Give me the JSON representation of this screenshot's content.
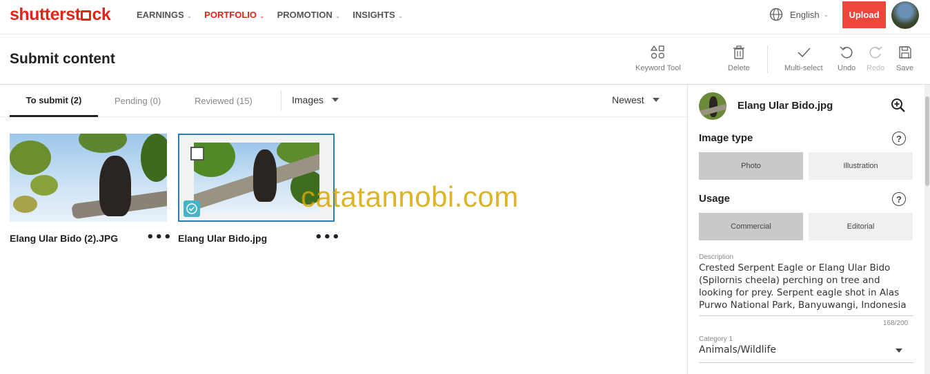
{
  "nav": {
    "logo_left": "shutterst",
    "logo_right": "ck",
    "items": [
      {
        "label": "EARNINGS",
        "active": false
      },
      {
        "label": "PORTFOLIO",
        "active": true
      },
      {
        "label": "PROMOTION",
        "active": false
      },
      {
        "label": "INSIGHTS",
        "active": false
      }
    ],
    "language": "English",
    "upload_label": "Upload"
  },
  "header": {
    "title": "Submit content",
    "tools": {
      "keyword_tool": "Keyword Tool",
      "delete": "Delete",
      "multi_select": "Multi-select",
      "undo": "Undo",
      "redo": "Redo",
      "save": "Save"
    }
  },
  "tabs": {
    "to_submit": "To submit (2)",
    "pending": "Pending (0)",
    "reviewed": "Reviewed (15)",
    "media_filter": "Images",
    "sort": "Newest"
  },
  "cards": [
    {
      "name": "Elang Ular Bido (2).JPG",
      "selected": false
    },
    {
      "name": "Elang Ular Bido.jpg",
      "selected": true
    }
  ],
  "watermark": "catatannobi.com",
  "panel": {
    "file_name": "Elang Ular Bido.jpg",
    "image_type_title": "Image type",
    "image_type_options": [
      "Photo",
      "Illustration"
    ],
    "image_type_selected": "Photo",
    "usage_title": "Usage",
    "usage_options": [
      "Commercial",
      "Editorial"
    ],
    "usage_selected": "Commercial",
    "description_label": "Description",
    "description": "Crested Serpent Eagle or Elang Ular Bido (Spilornis cheela) perching on tree and looking for prey. Serpent eagle shot in Alas Purwo National Park, Banyuwangi, Indonesia",
    "description_counter": "168/200",
    "category_label": "Category 1",
    "category_value": "Animals/Wildlife"
  },
  "colors": {
    "brand": "#e1251b",
    "upload": "#f0453a",
    "selection": "#2b7fa8",
    "badge": "#46b3c7"
  }
}
